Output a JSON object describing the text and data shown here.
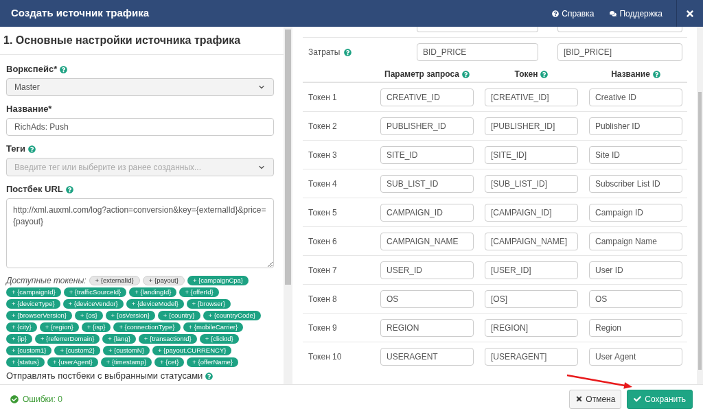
{
  "window": {
    "title": "Создать источник трафика",
    "links": [
      {
        "kind": "help",
        "label": "Справка"
      },
      {
        "kind": "support",
        "label": "Поддержка"
      }
    ]
  },
  "basic_settings": {
    "heading": "1. Основные настройки источника трафика",
    "workspace": {
      "label": "Воркспейс*",
      "value": "Master"
    },
    "name": {
      "label": "Название*",
      "value": "RichAds: Push"
    },
    "tags": {
      "label": "Теги",
      "placeholder": "Введите тег или выберите из ранее созданных..."
    },
    "postback_url": {
      "label": "Постбек URL",
      "value": "http://xml.auxml.com/log?action=conversion&key={externalId}&price={payout}"
    },
    "tokens_label": "Доступные токены:",
    "tokens": [
      {
        "label": "+ {externalId}",
        "used": true
      },
      {
        "label": "+ {payout}",
        "used": true
      },
      {
        "label": "+ {campaignCpa}",
        "used": false
      },
      {
        "label": "+ {campaignId}",
        "used": false
      },
      {
        "label": "+ {trafficSourceId}",
        "used": false
      },
      {
        "label": "+ {landingId}",
        "used": false
      },
      {
        "label": "+ {offerId}",
        "used": false
      },
      {
        "label": "+ {deviceType}",
        "used": false
      },
      {
        "label": "+ {deviceVendor}",
        "used": false
      },
      {
        "label": "+ {deviceModel}",
        "used": false
      },
      {
        "label": "+ {browser}",
        "used": false
      },
      {
        "label": "+ {browserVersion}",
        "used": false
      },
      {
        "label": "+ {os}",
        "used": false
      },
      {
        "label": "+ {osVersion}",
        "used": false
      },
      {
        "label": "+ {country}",
        "used": false
      },
      {
        "label": "+ {countryCode}",
        "used": false
      },
      {
        "label": "+ {city}",
        "used": false
      },
      {
        "label": "+ {region}",
        "used": false
      },
      {
        "label": "+ {isp}",
        "used": false
      },
      {
        "label": "+ {connectionType}",
        "used": false
      },
      {
        "label": "+ {mobileCarrier}",
        "used": false
      },
      {
        "label": "+ {ip}",
        "used": false
      },
      {
        "label": "+ {referrerDomain}",
        "used": false
      },
      {
        "label": "+ {lang}",
        "used": false
      },
      {
        "label": "+ {transactionId}",
        "used": false
      },
      {
        "label": "+ {clickId}",
        "used": false
      },
      {
        "label": "+ {custom1}",
        "used": false
      },
      {
        "label": "+ {custom2}",
        "used": false
      },
      {
        "label": "+ {customN}",
        "used": false
      },
      {
        "label": "+ {payout.CURRENCY}",
        "used": false
      },
      {
        "label": "+ {status}",
        "used": false
      },
      {
        "label": "+ {userAgent}",
        "used": false
      },
      {
        "label": "+ {timestamp}",
        "used": false
      },
      {
        "label": "+ {cet}",
        "used": false
      },
      {
        "label": "+ {offerName}",
        "used": false
      }
    ],
    "statuses_label": "Отправлять постбеки с выбранными статусами"
  },
  "parameters": {
    "cost": {
      "label": "Затраты",
      "parameter": "BID_PRICE",
      "token": "[BID_PRICE]"
    },
    "columns": [
      "Параметр запроса",
      "Токен",
      "Название"
    ],
    "rows": [
      {
        "label": "Токен 1",
        "parameter": "CREATIVE_ID",
        "token": "[CREATIVE_ID]",
        "name": "Creative ID"
      },
      {
        "label": "Токен 2",
        "parameter": "PUBLISHER_ID",
        "token": "[PUBLISHER_ID]",
        "name": "Publisher ID"
      },
      {
        "label": "Токен 3",
        "parameter": "SITE_ID",
        "token": "[SITE_ID]",
        "name": "Site ID"
      },
      {
        "label": "Токен 4",
        "parameter": "SUB_LIST_ID",
        "token": "[SUB_LIST_ID]",
        "name": "Subscriber List ID"
      },
      {
        "label": "Токен 5",
        "parameter": "CAMPAIGN_ID",
        "token": "[CAMPAIGN_ID]",
        "name": "Campaign ID"
      },
      {
        "label": "Токен 6",
        "parameter": "CAMPAIGN_NAME",
        "token": "[CAMPAIGN_NAME]",
        "name": "Campaign Name"
      },
      {
        "label": "Токен 7",
        "parameter": "USER_ID",
        "token": "[USER_ID]",
        "name": "User ID"
      },
      {
        "label": "Токен 8",
        "parameter": "OS",
        "token": "[OS]",
        "name": "OS"
      },
      {
        "label": "Токен 9",
        "parameter": "REGION",
        "token": "[REGION]",
        "name": "Region"
      },
      {
        "label": "Токен 10",
        "parameter": "USERAGENT",
        "token": "[USERAGENT]",
        "name": "User Agent"
      }
    ]
  },
  "footer": {
    "errors": "Ошибки: 0",
    "buttons": [
      {
        "kind": "cancel",
        "label": "Отмена"
      },
      {
        "kind": "save",
        "label": "Сохранить"
      }
    ]
  }
}
